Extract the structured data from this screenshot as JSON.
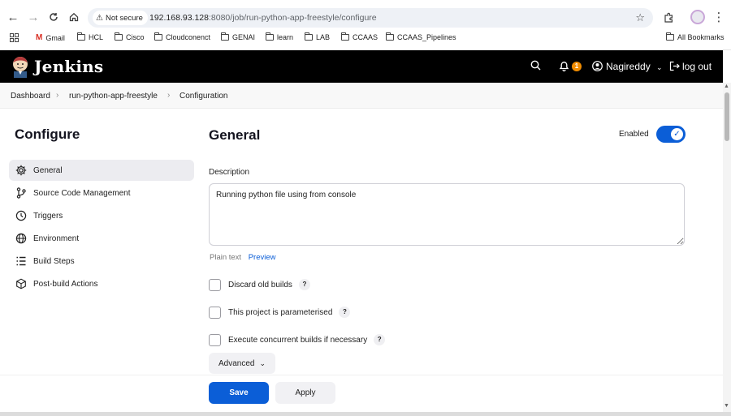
{
  "browser": {
    "security_label": "Not secure",
    "url_host": "192.168.93.128",
    "url_path": ":8080/job/run-python-app-freestyle/configure",
    "bookmarks": [
      "Gmail",
      "HCL",
      "Cisco",
      "Cloudconenct",
      "GENAI",
      "learn",
      "LAB",
      "CCAAS",
      "CCAAS_Pipelines"
    ],
    "all_bookmarks": "All Bookmarks"
  },
  "header": {
    "app_name": "Jenkins",
    "notification_count": "1",
    "user_name": "Nagireddy",
    "logout_label": "log out"
  },
  "breadcrumb": [
    "Dashboard",
    "run-python-app-freestyle",
    "Configuration"
  ],
  "sidebar": {
    "title": "Configure",
    "items": [
      {
        "label": "General",
        "icon": "gear-icon"
      },
      {
        "label": "Source Code Management",
        "icon": "branch-icon"
      },
      {
        "label": "Triggers",
        "icon": "clock-icon"
      },
      {
        "label": "Environment",
        "icon": "globe-icon"
      },
      {
        "label": "Build Steps",
        "icon": "list-icon"
      },
      {
        "label": "Post-build Actions",
        "icon": "cube-icon"
      }
    ]
  },
  "main": {
    "section_title": "General",
    "enabled_label": "Enabled",
    "enabled": true,
    "description_label": "Description",
    "description_value": "Running python file using from console",
    "plain_text_label": "Plain text",
    "preview_label": "Preview",
    "options": [
      {
        "label": "Discard old builds",
        "checked": false
      },
      {
        "label": "This project is parameterised",
        "checked": false
      },
      {
        "label": "Execute concurrent builds if necessary",
        "checked": false
      }
    ],
    "advanced_label": "Advanced",
    "save_label": "Save",
    "apply_label": "Apply"
  },
  "colors": {
    "accent": "#0b5ed7",
    "header_bg": "#000000",
    "badge": "#f08c00"
  }
}
